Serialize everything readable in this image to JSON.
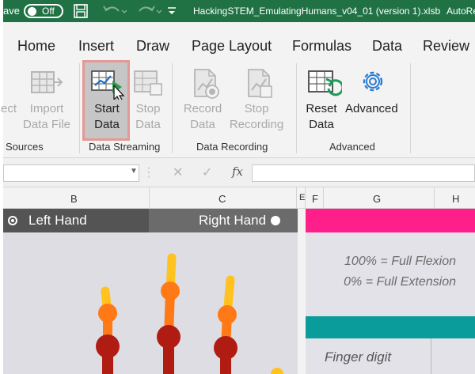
{
  "titlebar": {
    "autosave_partial": "ave",
    "autosave_state": "Off",
    "file_title": "HackingSTEM_EmulatingHumans_v04_01 (version 1).xlsb",
    "app_partial": "AutoRe",
    "icons": [
      "save-icon",
      "undo-icon",
      "redo-icon",
      "customize-toolbar-icon"
    ]
  },
  "tabs": [
    "Home",
    "Insert",
    "Draw",
    "Page Layout",
    "Formulas",
    "Data",
    "Review"
  ],
  "ribbon": {
    "sources": {
      "connect_partial": "ect",
      "import_line1": "Import",
      "import_line2": "Data File",
      "group_label": "Sources"
    },
    "data_streaming": {
      "start_line1": "Start",
      "start_line2": "Data",
      "stop_line1": "Stop",
      "stop_line2": "Data",
      "group_label": "Data Streaming"
    },
    "data_recording": {
      "record_line1": "Record",
      "record_line2": "Data",
      "stop_line1": "Stop",
      "stop_line2": "Recording",
      "group_label": "Data Recording"
    },
    "advanced": {
      "reset_line1": "Reset",
      "reset_line2": "Data",
      "advanced_label": "Advanced",
      "group_label": "Advanced"
    }
  },
  "formula_bar": {
    "cancel_icon": "✕",
    "enter_icon": "✓",
    "fx": "fx",
    "value": ""
  },
  "columns": [
    "B",
    "C",
    "E",
    "F",
    "G",
    "H"
  ],
  "sheet": {
    "left_hand": "Left Hand",
    "right_hand": "Right Hand",
    "legend_full_flexion": "100% = Full Flexion",
    "legend_full_extension": "0% = Full Extension",
    "finger_digit": "Finger digit"
  },
  "colors": {
    "excel_green": "#207245",
    "highlight_border": "#e29a96",
    "pink_band": "#ff1f8a",
    "teal_band": "#0a9b9b",
    "finger_dark_red": "#b01c12",
    "finger_orange": "#ff7a17",
    "finger_yellow": "#ffc21f"
  }
}
